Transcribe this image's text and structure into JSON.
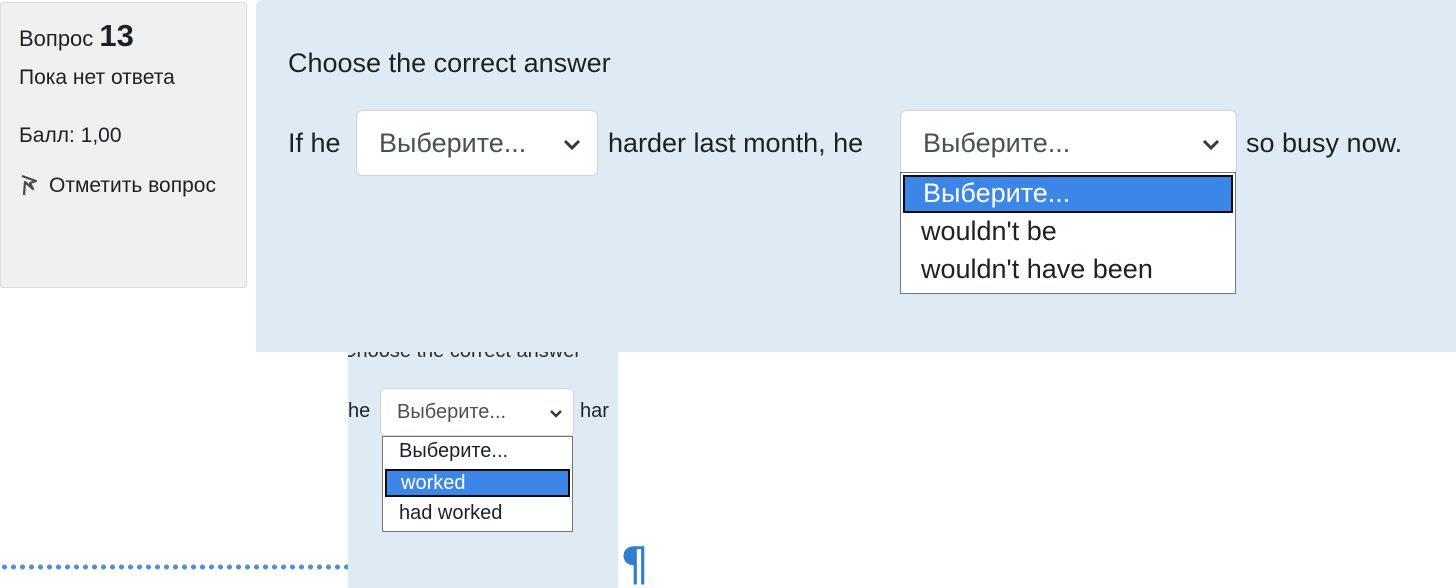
{
  "info": {
    "question_word": "Вопрос",
    "question_number": "13",
    "state": "Пока нет ответа",
    "grade": "Балл: 1,00",
    "flag_label": "Отметить вопрос",
    "flag_icon": "flag-icon"
  },
  "question": {
    "prompt": "Choose the correct answer",
    "text_before": "If he",
    "text_middle": "harder last month, he",
    "text_after": "so busy now.",
    "select1_value": "Выберите...",
    "select2_value": "Выберите...",
    "dropdown2_options": [
      "Выберите...",
      "wouldn't be",
      "wouldn't have been"
    ],
    "dropdown2_selected_index": 0
  },
  "crop": {
    "ghost_prompt": "Choose the correct answer",
    "text_before": "he",
    "select_value": "Выберите...",
    "text_after": "har",
    "dropdown_options": [
      "Выберите...",
      "worked",
      "had worked"
    ],
    "dropdown_selected_index": 1
  },
  "pilcrow": "¶",
  "colors": {
    "panel_bg": "#f0f0f0",
    "content_bg": "#deebf4",
    "highlight": "#3b86e6",
    "dots": "#4f90d3"
  }
}
